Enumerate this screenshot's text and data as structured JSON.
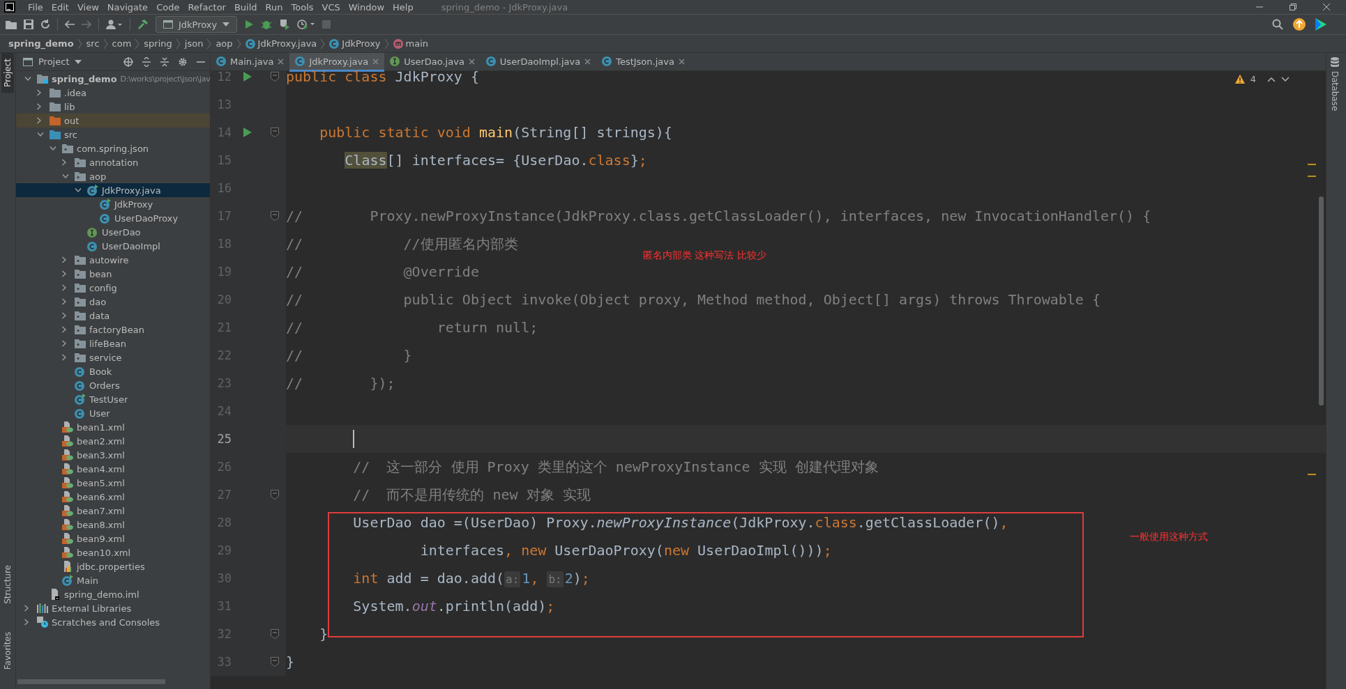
{
  "window": {
    "title": "spring_demo - JdkProxy.java"
  },
  "menu": [
    "File",
    "Edit",
    "View",
    "Navigate",
    "Code",
    "Refactor",
    "Build",
    "Run",
    "Tools",
    "VCS",
    "Window",
    "Help"
  ],
  "toolbar": {
    "run_configuration": "JdkProxy"
  },
  "breadcrumb": [
    {
      "label": "spring_demo",
      "kind": "project"
    },
    {
      "label": "src",
      "kind": "dir"
    },
    {
      "label": "com",
      "kind": "dir"
    },
    {
      "label": "spring",
      "kind": "dir"
    },
    {
      "label": "json",
      "kind": "dir"
    },
    {
      "label": "aop",
      "kind": "dir"
    },
    {
      "label": "JdkProxy.java",
      "kind": "class"
    },
    {
      "label": "JdkProxy",
      "kind": "class"
    },
    {
      "label": "main",
      "kind": "method"
    }
  ],
  "left_stripe": [
    {
      "label": "Project",
      "selected": true
    },
    {
      "label": "Structure",
      "selected": false
    },
    {
      "label": "Favorites",
      "selected": false
    }
  ],
  "right_stripe": [
    {
      "label": "Database",
      "selected": false
    }
  ],
  "project": {
    "title": "Project",
    "tree": [
      {
        "label": "spring_demo",
        "kind": "module",
        "hint": "D:\\works\\project\\json\\jav",
        "expanded": true,
        "selected": false,
        "children": [
          {
            "label": ".idea",
            "kind": "folder",
            "expanded": false,
            "selected": false
          },
          {
            "label": "lib",
            "kind": "folder",
            "expanded": false,
            "selected": false
          },
          {
            "label": "out",
            "kind": "excluded",
            "expanded": false,
            "selected": false
          },
          {
            "label": "src",
            "kind": "source",
            "expanded": true,
            "selected": false,
            "children": [
              {
                "label": "com.spring.json",
                "kind": "package",
                "expanded": true,
                "selected": false,
                "children": [
                  {
                    "label": "annotation",
                    "kind": "package",
                    "expanded": false,
                    "selected": false
                  },
                  {
                    "label": "aop",
                    "kind": "package",
                    "expanded": true,
                    "selected": false,
                    "children": [
                      {
                        "label": "JdkProxy.java",
                        "kind": "class-run",
                        "expanded": true,
                        "selected": true,
                        "children": [
                          {
                            "label": "JdkProxy",
                            "kind": "class-run",
                            "selected": false
                          },
                          {
                            "label": "UserDaoProxy",
                            "kind": "class",
                            "selected": false
                          }
                        ]
                      },
                      {
                        "label": "UserDao",
                        "kind": "interface",
                        "selected": false
                      },
                      {
                        "label": "UserDaoImpl",
                        "kind": "class",
                        "selected": false
                      }
                    ]
                  },
                  {
                    "label": "autowire",
                    "kind": "package",
                    "expanded": false,
                    "selected": false
                  },
                  {
                    "label": "bean",
                    "kind": "package",
                    "expanded": false,
                    "selected": false
                  },
                  {
                    "label": "config",
                    "kind": "package",
                    "expanded": false,
                    "selected": false
                  },
                  {
                    "label": "dao",
                    "kind": "package",
                    "expanded": false,
                    "selected": false
                  },
                  {
                    "label": "data",
                    "kind": "package",
                    "expanded": false,
                    "selected": false
                  },
                  {
                    "label": "factoryBean",
                    "kind": "package",
                    "expanded": false,
                    "selected": false
                  },
                  {
                    "label": "lifeBean",
                    "kind": "package",
                    "expanded": false,
                    "selected": false
                  },
                  {
                    "label": "service",
                    "kind": "package",
                    "expanded": false,
                    "selected": false
                  },
                  {
                    "label": "Book",
                    "kind": "class",
                    "selected": false
                  },
                  {
                    "label": "Orders",
                    "kind": "class",
                    "selected": false
                  },
                  {
                    "label": "TestUser",
                    "kind": "class-run",
                    "selected": false
                  },
                  {
                    "label": "User",
                    "kind": "class",
                    "selected": false
                  }
                ]
              },
              {
                "label": "bean1.xml",
                "kind": "xml",
                "selected": false
              },
              {
                "label": "bean2.xml",
                "kind": "xml",
                "selected": false
              },
              {
                "label": "bean3.xml",
                "kind": "xml",
                "selected": false
              },
              {
                "label": "bean4.xml",
                "kind": "xml",
                "selected": false
              },
              {
                "label": "bean5.xml",
                "kind": "xml",
                "selected": false
              },
              {
                "label": "bean6.xml",
                "kind": "xml",
                "selected": false
              },
              {
                "label": "bean7.xml",
                "kind": "xml",
                "selected": false
              },
              {
                "label": "bean8.xml",
                "kind": "xml",
                "selected": false
              },
              {
                "label": "bean9.xml",
                "kind": "xml",
                "selected": false
              },
              {
                "label": "bean10.xml",
                "kind": "xml",
                "selected": false
              },
              {
                "label": "jdbc.properties",
                "kind": "properties",
                "selected": false
              },
              {
                "label": "Main",
                "kind": "class-run",
                "selected": false
              }
            ]
          },
          {
            "label": "spring_demo.iml",
            "kind": "iml",
            "selected": false
          }
        ]
      },
      {
        "label": "External Libraries",
        "kind": "libraries",
        "expanded": false,
        "selected": false
      },
      {
        "label": "Scratches and Consoles",
        "kind": "scratches",
        "expanded": false,
        "selected": false
      }
    ]
  },
  "editor_tabs": [
    {
      "label": "Main.java",
      "kind": "class",
      "selected": false
    },
    {
      "label": "JdkProxy.java",
      "kind": "class",
      "selected": true
    },
    {
      "label": "UserDao.java",
      "kind": "interface",
      "selected": false
    },
    {
      "label": "UserDaoImpl.java",
      "kind": "class",
      "selected": false
    },
    {
      "label": "TestJson.java",
      "kind": "class",
      "selected": false
    }
  ],
  "inspections": {
    "warnings": "4"
  },
  "code": [
    {
      "number": "12",
      "run": true,
      "fold": true,
      "tokens": [
        {
          "kind": "keyword",
          "t": "public class "
        },
        {
          "kind": "plain",
          "t": "JdkProxy {"
        }
      ]
    },
    {
      "number": "13"
    },
    {
      "number": "14",
      "run": true,
      "fold": true,
      "tokens": [
        {
          "kind": "keyword",
          "t": "    public static void "
        },
        {
          "kind": "method",
          "t": "main"
        },
        {
          "kind": "plain",
          "t": "(String[] strings){"
        }
      ]
    },
    {
      "number": "15",
      "tokens": [
        {
          "kind": "marked",
          "t": "       Class"
        },
        {
          "kind": "plain",
          "t": "[] interfaces= {UserDao."
        },
        {
          "kind": "keyword",
          "t": "class"
        },
        {
          "kind": "plain",
          "t": "}"
        },
        {
          "kind": "keyword",
          "t": ";"
        }
      ]
    },
    {
      "number": "16"
    },
    {
      "number": "17",
      "fold": true,
      "tokens": [
        {
          "kind": "comment",
          "t": "//        Proxy.newProxyInstance(JdkProxy.class.getClassLoader(), interfaces, new InvocationHandler() {"
        }
      ]
    },
    {
      "number": "18",
      "tokens": [
        {
          "kind": "comment",
          "t": "//            //使用匿名内部类"
        }
      ],
      "note": "匿名内部类 这种写法 比较少"
    },
    {
      "number": "19",
      "tokens": [
        {
          "kind": "comment",
          "t": "//            @Override"
        }
      ]
    },
    {
      "number": "20",
      "tokens": [
        {
          "kind": "comment",
          "t": "//            public Object invoke(Object proxy, Method method, Object[] args) throws Throwable {"
        }
      ]
    },
    {
      "number": "21",
      "tokens": [
        {
          "kind": "comment",
          "t": "//                return null;"
        }
      ]
    },
    {
      "number": "22",
      "tokens": [
        {
          "kind": "comment",
          "t": "//            }"
        }
      ]
    },
    {
      "number": "23",
      "tokens": [
        {
          "kind": "comment",
          "t": "//        });"
        }
      ]
    },
    {
      "number": "24"
    },
    {
      "number": "25",
      "current": true,
      "cursor": true
    },
    {
      "number": "26",
      "tokens": [
        {
          "kind": "comment",
          "t": "        //  这一部分 使用 Proxy 类里的这个 newProxyInstance 实现 创建代理对象"
        }
      ]
    },
    {
      "number": "27",
      "fold": true,
      "tokens": [
        {
          "kind": "comment",
          "t": "        //  而不是用传统的 new 对象 实现"
        }
      ]
    },
    {
      "number": "28",
      "boxed": true,
      "note": "一般使用这种方式",
      "tokens": [
        {
          "kind": "plain",
          "t": "        UserDao dao =(UserDao) Proxy."
        },
        {
          "kind": "static",
          "t": "newProxyInstance"
        },
        {
          "kind": "plain",
          "t": "(JdkProxy."
        },
        {
          "kind": "keyword",
          "t": "class"
        },
        {
          "kind": "plain",
          "t": ".getClassLoader()"
        },
        {
          "kind": "keyword",
          "t": ","
        }
      ]
    },
    {
      "number": "29",
      "boxed": true,
      "tokens": [
        {
          "kind": "plain",
          "t": "                interfaces"
        },
        {
          "kind": "keyword",
          "t": ", new "
        },
        {
          "kind": "plain",
          "t": "UserDaoProxy("
        },
        {
          "kind": "keyword",
          "t": "new "
        },
        {
          "kind": "plain",
          "t": "UserDaoImpl()))"
        },
        {
          "kind": "keyword",
          "t": ";"
        }
      ]
    },
    {
      "number": "30",
      "boxed": true,
      "tokens": [
        {
          "kind": "keyword",
          "t": "        int "
        },
        {
          "kind": "plain",
          "t": "add = dao.add("
        },
        {
          "kind": "hint",
          "t": "a:"
        },
        {
          "kind": "number",
          "t": "1"
        },
        {
          "kind": "keyword",
          "t": ", "
        },
        {
          "kind": "hint",
          "t": "b:"
        },
        {
          "kind": "number",
          "t": "2"
        },
        {
          "kind": "plain",
          "t": ")"
        },
        {
          "kind": "keyword",
          "t": ";"
        }
      ]
    },
    {
      "number": "31",
      "boxed": true,
      "tokens": [
        {
          "kind": "plain",
          "t": "        System."
        },
        {
          "kind": "field",
          "t": "out"
        },
        {
          "kind": "plain",
          "t": ".println(add)"
        },
        {
          "kind": "keyword",
          "t": ";"
        }
      ]
    },
    {
      "number": "32",
      "fold": true,
      "tokens": [
        {
          "kind": "plain",
          "t": "    }"
        }
      ]
    },
    {
      "number": "33",
      "fold": true,
      "tokens": [
        {
          "kind": "plain",
          "t": "}"
        }
      ]
    }
  ]
}
